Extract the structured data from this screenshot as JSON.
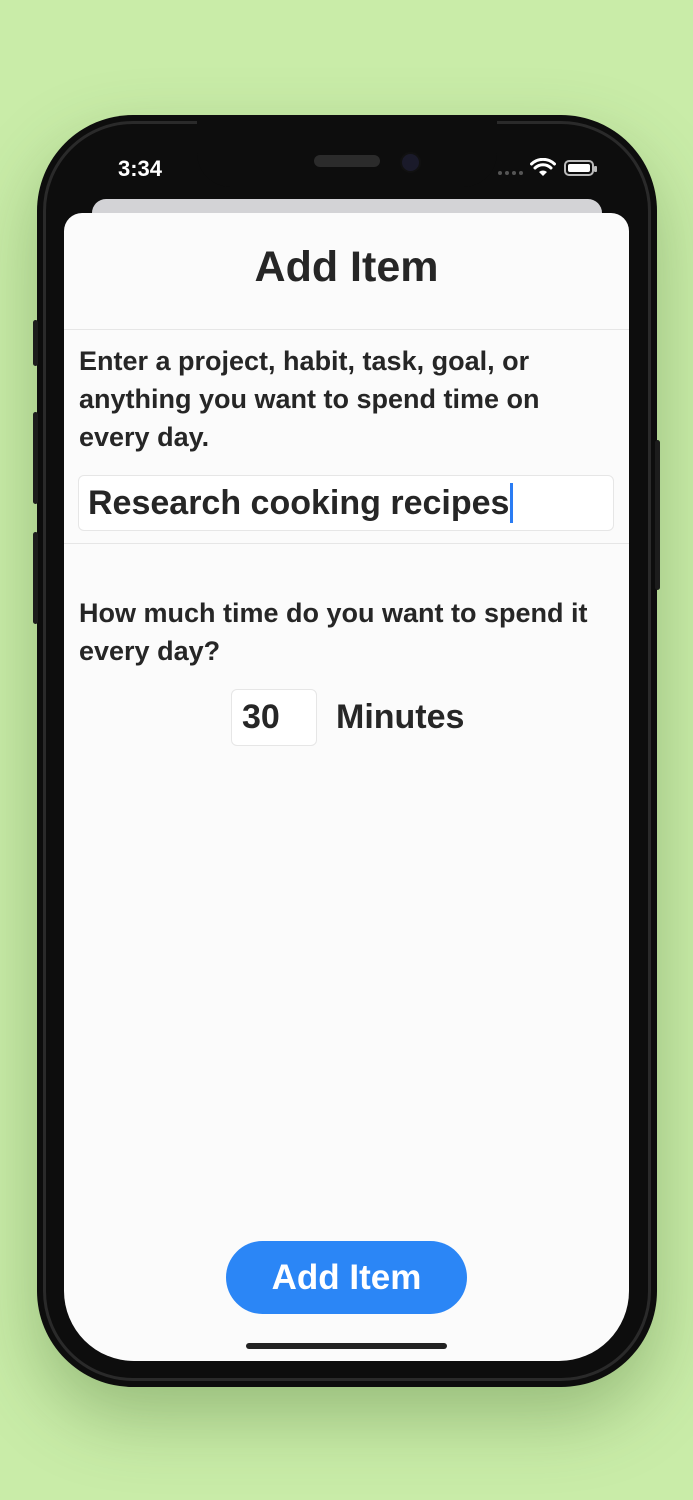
{
  "status_bar": {
    "time": "3:34",
    "wifi_icon": "wifi-icon",
    "battery_icon": "battery-icon"
  },
  "sheet": {
    "title": "Add Item",
    "item_prompt": "Enter a project, habit, task, goal, or anything you want to spend time on every day.",
    "item_value": "Research cooking recipes",
    "time_prompt": "How much time do you want to spend it every day?",
    "minutes_value": "30",
    "minutes_label": "Minutes",
    "add_button_label": "Add Item"
  },
  "colors": {
    "background": "#c9eca8",
    "accent": "#2b86f6",
    "cursor": "#2a7cf3",
    "text": "#262626"
  }
}
